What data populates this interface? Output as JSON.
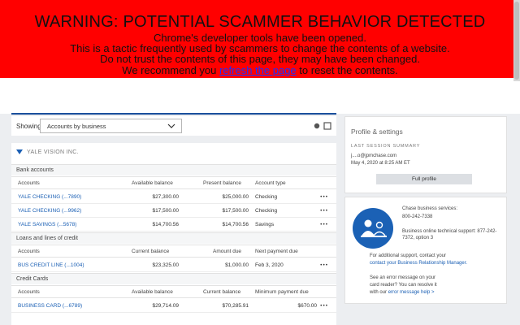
{
  "warning": {
    "title": "WARNING: POTENTIAL SCAMMER BEHAVIOR DETECTED",
    "line1": "Chrome's developer tools have been opened.",
    "line2": "This is a tactic frequently used by scammers to change the contents of a website.",
    "line3": "Do not trust the contents of this page, they may have been changed.",
    "line4_before": "We recommend you ",
    "line4_link": "refresh the page",
    "line4_after": " to reset the contents."
  },
  "toolbar": {
    "showing_label": "Showing",
    "view_select": "Accounts by business"
  },
  "business": {
    "name": "YALE VISION INC."
  },
  "bank_accounts": {
    "section": "Bank accounts",
    "headers": [
      "Accounts",
      "Available balance",
      "Present balance",
      "Account type"
    ],
    "rows": [
      {
        "account": "YALE CHECKING (...7890)",
        "available": "$27,300.00",
        "present": "$25,000.00",
        "type": "Checking"
      },
      {
        "account": "YALE CHECKING (...9962)",
        "available": "$17,500.00",
        "present": "$17,500.00",
        "type": "Checking"
      },
      {
        "account": "YALE SAVINGS (...5678)",
        "available": "$14,700.56",
        "present": "$14,700.56",
        "type": "Savings"
      }
    ]
  },
  "loans": {
    "section": "Loans and lines of credit",
    "headers": [
      "Accounts",
      "Current balance",
      "Amount due",
      "Next payment due"
    ],
    "rows": [
      {
        "account": "BUS CREDIT LINE (...1004)",
        "current": "$23,325.00",
        "due": "$1,000.00",
        "next": "Feb 3, 2020"
      }
    ]
  },
  "credit_cards": {
    "section": "Credit Cards",
    "headers": [
      "Accounts",
      "Available balance",
      "Current balance",
      "Minimum payment due"
    ],
    "rows": [
      {
        "account": "BUSINESS CARD (...6789)",
        "available": "$29,714.09",
        "current": "$70,285.91",
        "minimum": "$670.00"
      }
    ]
  },
  "profile": {
    "title": "Profile & settings",
    "last_session": "LAST SESSION SUMMARY",
    "email": "j....o@jpmchase.com",
    "date": "May 4, 2020 at 8:25 AM ET",
    "full_profile": "Full profile"
  },
  "support": {
    "services_label": "Chase business services:",
    "services_phone": "800-242-7338",
    "online_support": "Business online technical support: 877-242-7372, option 3",
    "additional_1": "For additional support, contact your",
    "additional_link": "contact your Business Relationship Manager.",
    "error_1": "See an error message on your",
    "error_2": "card reader? You can resolve it",
    "error_3_before": "with our ",
    "error_3_link": "error message help",
    "error_3_after": " >"
  },
  "colors": {
    "banner": "#ff0000",
    "link": "#1a5fb4",
    "brand_blue": "#1b61b5"
  }
}
